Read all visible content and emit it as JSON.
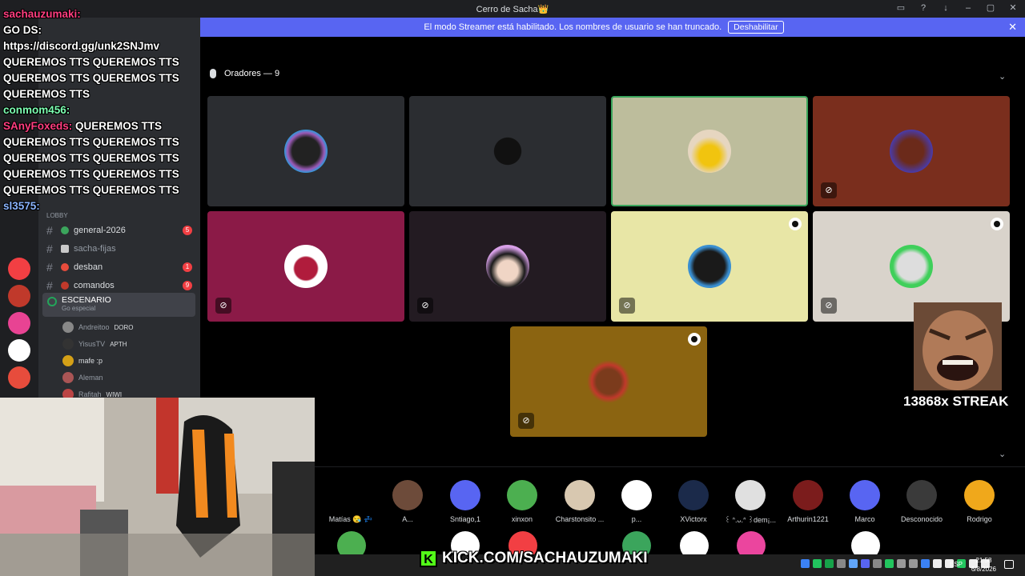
{
  "window": {
    "title": "Cerro de Sacha👑"
  },
  "banner": {
    "text": "El modo Streamer está habilitado. Los nombres de usuario se han truncado.",
    "button": "Deshabilitar"
  },
  "chat": {
    "lines": [
      {
        "user": "sachauzumaki:",
        "color": "pink"
      },
      {
        "text": "GO DS:"
      },
      {
        "text": "https://discord.gg/unk2SNJmv"
      },
      {
        "text": "QUEREMOS TTS QUEREMOS TTS QUEREMOS TTS QUEREMOS TTS QUEREMOS TTS"
      },
      {
        "user": "conmom456:",
        "color": "green"
      },
      {
        "user": "SAnyFoxeds:",
        "text": "QUEREMOS TTS QUEREMOS TTS QUEREMOS TTS QUEREMOS TTS QUEREMOS TTS QUEREMOS TTS QUEREMOS TTS QUEREMOS TTS QUEREMOS TTS",
        "color": "pink"
      },
      {
        "user": "sl3575:",
        "color": "blue"
      }
    ]
  },
  "sidebar": {
    "category": "LOBBY",
    "channels": [
      {
        "name": "general-2026",
        "badge": "5",
        "emoji_color": "#3ba55c"
      },
      {
        "name": "sacha-fijas",
        "badge": "",
        "emoji_color": "#c9c9c9"
      },
      {
        "name": "desban",
        "badge": "1",
        "emoji_color": "#e74c3c"
      },
      {
        "name": "comandos",
        "badge": "9",
        "emoji_color": "#c0392b"
      }
    ],
    "stage": {
      "name": "ESCENARIO",
      "sub": "Go especial"
    },
    "users": [
      {
        "name": "Andreitoo",
        "tag": "DORO"
      },
      {
        "name": "YisusTV",
        "tag": "APTH"
      },
      {
        "name": "mafe :p",
        "tag": ""
      },
      {
        "name": "Aleman",
        "tag": ""
      },
      {
        "name": "Rafitah",
        "tag": "WIWI"
      }
    ]
  },
  "stage_header": {
    "label": "Oradores — 9"
  },
  "tiles": [
    {
      "bg": "#2b2d31",
      "muted": false,
      "mod": false
    },
    {
      "bg": "#2b2d31",
      "muted": false,
      "mod": false
    },
    {
      "bg": "#bdbd9c",
      "muted": false,
      "mod": false,
      "speaking": true
    },
    {
      "bg": "#7a2e1d",
      "muted": true,
      "mod": false
    },
    {
      "bg": "#8b1a47",
      "muted": true,
      "mod": false
    },
    {
      "bg": "#231b22",
      "muted": true,
      "mod": false
    },
    {
      "bg": "#e8e6a6",
      "muted": true,
      "mod": true
    },
    {
      "bg": "#d9d3cb",
      "muted": true,
      "mod": true
    },
    {
      "bg": "#8b6411",
      "muted": true,
      "mod": true
    }
  ],
  "audience": [
    {
      "name": "Matías 😪 💤",
      "color": "#000"
    },
    {
      "name": "A...",
      "color": "#6d4b3a"
    },
    {
      "name": "Sntiago,1",
      "color": "#5865f2"
    },
    {
      "name": "xinxon",
      "color": "#4caf50"
    },
    {
      "name": "Charstonsito ...",
      "color": "#d8c8b0"
    },
    {
      "name": "p...",
      "color": "#fff"
    },
    {
      "name": "XVictorx",
      "color": "#1b2a4a"
    },
    {
      "name": "꒰ ᐢ.ᴗ.ᐢ ꒱dem¡...",
      "color": "#e0e0e0"
    },
    {
      "name": "Arthurin1221",
      "color": "#7b1c1c"
    },
    {
      "name": "Marco",
      "color": "#5865f2"
    },
    {
      "name": "Desconocido",
      "color": "#3a3a3a"
    },
    {
      "name": "Rodrigo",
      "color": "#f0a81b"
    }
  ],
  "overlay": {
    "streak": "13868x STREAK",
    "kick_url": "KICK.COM/SACHAUZUMAKI",
    "kick_logo": "K"
  },
  "taskbar": {
    "lang": "ESP",
    "time": "21:58",
    "date": "6/8/2026"
  }
}
